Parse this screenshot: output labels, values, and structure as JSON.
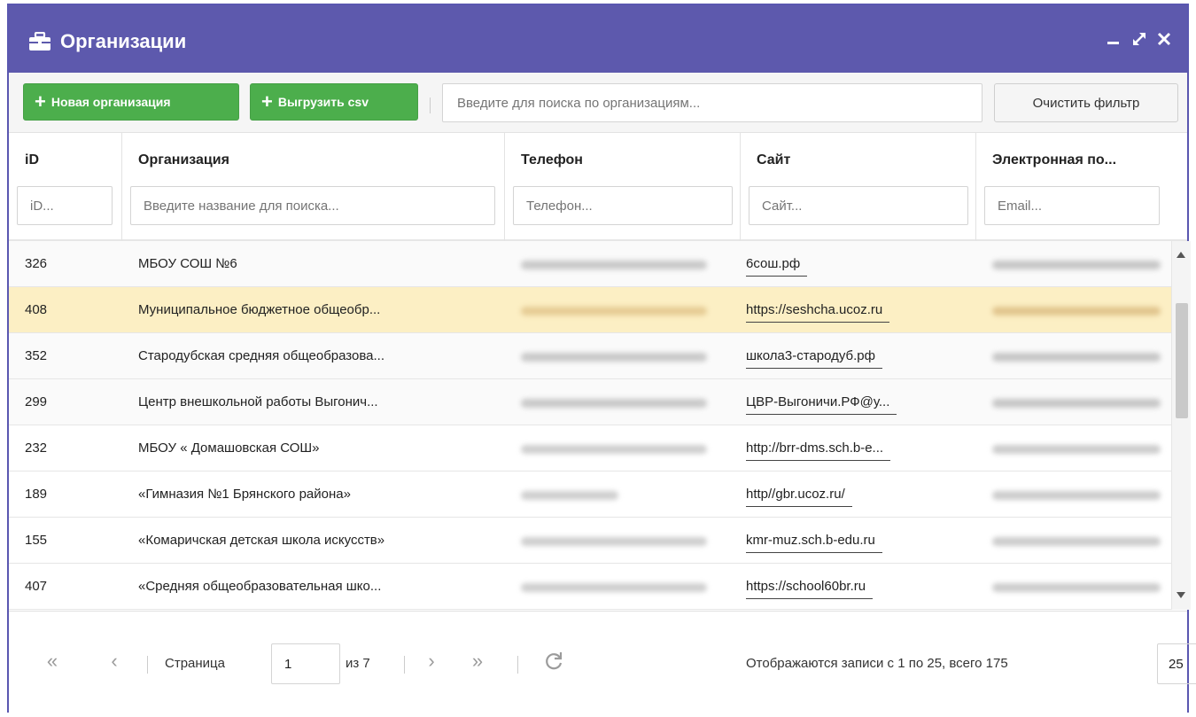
{
  "window": {
    "title": "Организации",
    "title_icon": "briefcase-icon",
    "controls": [
      "minimize-icon",
      "maximize-icon",
      "close-icon"
    ],
    "title_color": "#5d59ad"
  },
  "toolbar": {
    "new_org_label": "Новая организация",
    "export_label": "Выгрузить csv",
    "search_placeholder": "Введите для поиска по организациям...",
    "clear_filter_label": "Очистить фильтр"
  },
  "columns": [
    {
      "label": "iD",
      "filter_placeholder": "iD..."
    },
    {
      "label": "Организация",
      "filter_placeholder": "Введите название для поиска..."
    },
    {
      "label": "Телефон",
      "filter_placeholder": "Телефон..."
    },
    {
      "label": "Сайт",
      "filter_placeholder": "Сайт..."
    },
    {
      "label": "Электронная по...",
      "filter_placeholder": "Email..."
    }
  ],
  "rows": [
    {
      "id": "326",
      "name": "МБОУ СОШ №6",
      "site": "6сош.рф"
    },
    {
      "id": "408",
      "name": "Муниципальное бюджетное общеобр...",
      "site": "https://seshcha.ucoz.ru"
    },
    {
      "id": "352",
      "name": "Стародубская средняя общеобразова...",
      "site": "школа3-стародуб.рф"
    },
    {
      "id": "299",
      "name": "Центр внешкольной работы Выгонич...",
      "site": "ЦВР-Выгоничи.РФ@у..."
    },
    {
      "id": "232",
      "name": "МБОУ « Домашовская СОШ»",
      "site": "http://brr-dms.sch.b-e..."
    },
    {
      "id": "189",
      "name": "«Гимназия №1 Брянского района»",
      "site": "http//gbr.ucoz.ru/"
    },
    {
      "id": "155",
      "name": "«Комаричская детская школа искусств»",
      "site": "kmr-muz.sch.b-edu.ru"
    },
    {
      "id": "407",
      "name": "«Средняя общеобразовательная шко...",
      "site": "https://school60br.ru"
    }
  ],
  "selected_row_id": "408",
  "pagination": {
    "page_label": "Страница",
    "current_page": "1",
    "of_label": "из 7",
    "records_text": "Отображаются записи с 1 по 25, всего 175",
    "page_size": "25"
  },
  "colors": {
    "accent": "#5d59ad",
    "green": "#4cae4c",
    "selected_row": "#fcefc4"
  }
}
